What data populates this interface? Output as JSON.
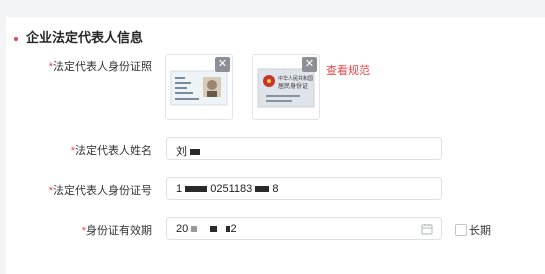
{
  "section": {
    "title": "企业法定代表人信息"
  },
  "fields": {
    "id_photo": {
      "required": "*",
      "label": "法定代表人身份证照"
    },
    "name": {
      "required": "*",
      "label": "法定代表人姓名",
      "value": "刘",
      "value_tail": ""
    },
    "id_number": {
      "required": "*",
      "label": "法定代表人身份证号",
      "value_head": "1",
      "value_mid": "0251183",
      "value_tail": "8"
    },
    "validity": {
      "required": "*",
      "label": "身份证有效期",
      "value_head": "20",
      "value_tail": "2"
    }
  },
  "upload": {
    "view_spec_link": "查看规范",
    "back_card_title": "中华人民共和国",
    "back_card_subtitle": "居民身份证"
  },
  "long_term": {
    "label": "长期",
    "checked": false
  },
  "colors": {
    "accent": "#e64545",
    "border": "#dcdfe6"
  },
  "icons": {
    "remove": "close-icon",
    "date": "calendar-icon"
  }
}
